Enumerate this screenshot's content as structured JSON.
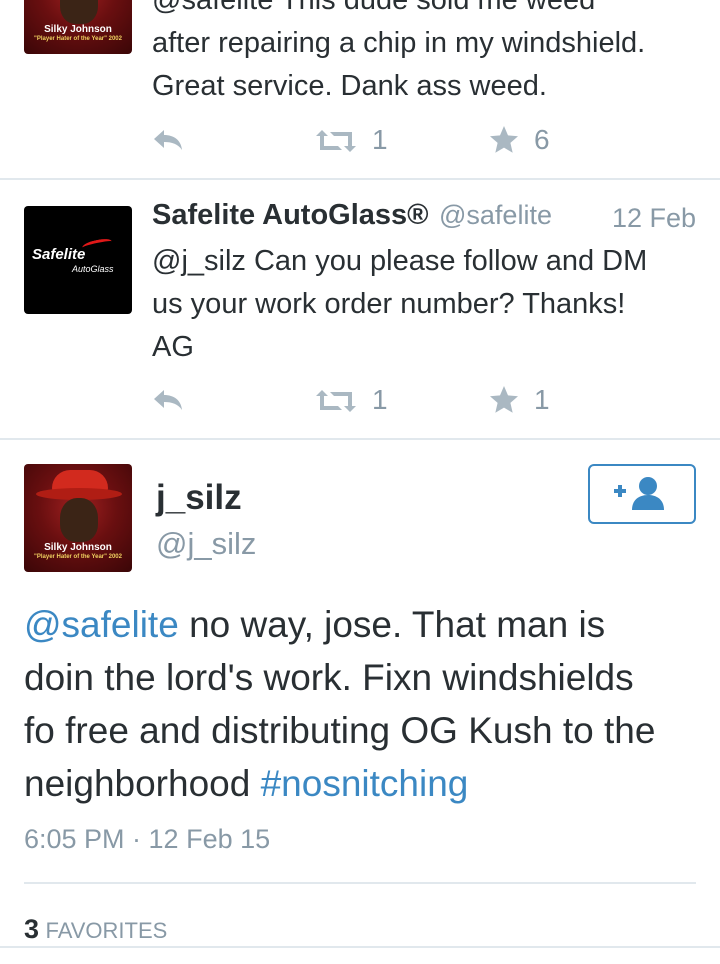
{
  "tweets": [
    {
      "avatar_caption": "Silky Johnson",
      "avatar_subcaption": "\"Player Hater of the Year\" 2002",
      "text_line1": "@safelite This dude sold me weed",
      "text_line2": "after repairing a chip in my windshield.",
      "text_line3": "Great service.  Dank ass weed.",
      "retweets": "1",
      "favorites": "6"
    },
    {
      "name": "Safelite AutoGlass®",
      "handle": "@safelite",
      "date": "12 Feb",
      "avatar_logo_top": "Safelite",
      "avatar_logo_bottom": "AutoGlass",
      "text_line1": "@j_silz Can you please follow and DM",
      "text_line2": "us your work order number? Thanks!",
      "text_line3": "AG",
      "retweets": "1",
      "favorites": "1"
    }
  ],
  "focused": {
    "name": "j_silz",
    "handle": "@j_silz",
    "avatar_caption": "Silky Johnson",
    "avatar_subcaption": "\"Player Hater of the Year\" 2002",
    "mention": "@safelite",
    "line1_rest": " no way, jose. That man is",
    "line2": "doin the lord's work. Fixn windshields",
    "line3": "fo free and distributing OG Kush to the",
    "line4": "neighborhood ",
    "hashtag": "#nosnitching",
    "timestamp": "6:05 PM · 12 Feb 15",
    "favorites_count": "3",
    "favorites_label": "FAVORITES"
  },
  "colors": {
    "link": "#3b88c3",
    "muted": "#8899a6",
    "icon": "#aab8c2",
    "divider": "#e1e8ed"
  }
}
